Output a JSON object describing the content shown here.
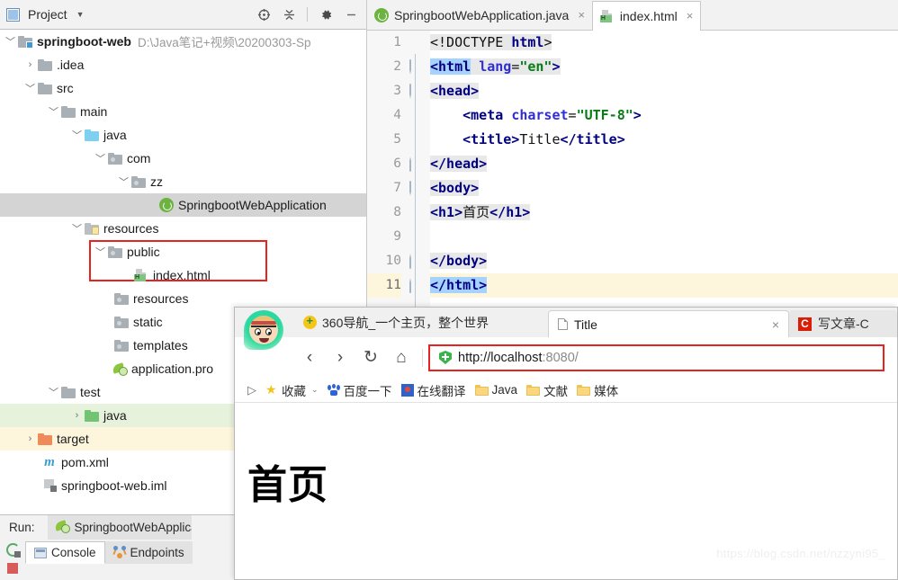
{
  "ide": {
    "project_panel": {
      "title": "Project",
      "toolbar_icons": [
        "locate-icon",
        "collapse-all-icon",
        "settings-gear-icon",
        "minimize-icon"
      ],
      "tree": [
        {
          "label": "springboot-web",
          "path": "D:\\Java笔记+视频\\20200303-Sp",
          "icon": "project-root-folder-icon",
          "arrow": "expanded",
          "indent": 0,
          "bold": true,
          "state": "normal"
        },
        {
          "label": ".idea",
          "path": "",
          "icon": "folder-grey-icon",
          "arrow": "collapsed",
          "indent": 1,
          "bold": false,
          "state": "normal"
        },
        {
          "label": "src",
          "path": "",
          "icon": "folder-grey-icon",
          "arrow": "expanded",
          "indent": 1,
          "bold": false,
          "state": "normal"
        },
        {
          "label": "main",
          "path": "",
          "icon": "folder-grey-icon",
          "arrow": "expanded",
          "indent": 2,
          "bold": false,
          "state": "normal"
        },
        {
          "label": "java",
          "path": "",
          "icon": "folder-blue-source-icon",
          "arrow": "expanded",
          "indent": 3,
          "bold": false,
          "state": "normal"
        },
        {
          "label": "com",
          "path": "",
          "icon": "package-icon",
          "arrow": "expanded",
          "indent": 4,
          "bold": false,
          "state": "normal"
        },
        {
          "label": "zz",
          "path": "",
          "icon": "package-icon",
          "arrow": "expanded",
          "indent": 5,
          "bold": false,
          "state": "normal"
        },
        {
          "label": "SpringbootWebApplication",
          "path": "",
          "icon": "spring-boot-class-icon",
          "arrow": "none",
          "indent": 6,
          "bold": false,
          "state": "selected"
        },
        {
          "label": "resources",
          "path": "",
          "icon": "folder-resources-icon",
          "arrow": "expanded",
          "indent": 3,
          "bold": false,
          "state": "normal"
        },
        {
          "label": "public",
          "path": "",
          "icon": "package-icon",
          "arrow": "expanded",
          "indent": 4,
          "bold": false,
          "state": "normal",
          "highlight": "red-box-top"
        },
        {
          "label": "index.html",
          "path": "",
          "icon": "html-file-icon",
          "arrow": "none",
          "indent": 5,
          "bold": false,
          "state": "normal",
          "highlight": "red-box-bottom"
        },
        {
          "label": "resources",
          "path": "",
          "icon": "package-icon",
          "arrow": "none",
          "indent": 4,
          "bold": false,
          "state": "normal"
        },
        {
          "label": "static",
          "path": "",
          "icon": "package-icon",
          "arrow": "none",
          "indent": 4,
          "bold": false,
          "state": "normal"
        },
        {
          "label": "templates",
          "path": "",
          "icon": "package-icon",
          "arrow": "none",
          "indent": 4,
          "bold": false,
          "state": "normal"
        },
        {
          "label": "application.pro",
          "path": "",
          "icon": "spring-properties-icon",
          "arrow": "none",
          "indent": 4,
          "bold": false,
          "state": "normal"
        },
        {
          "label": "test",
          "path": "",
          "icon": "folder-grey-icon",
          "arrow": "expanded",
          "indent": 2,
          "bold": false,
          "state": "normal"
        },
        {
          "label": "java",
          "path": "",
          "icon": "folder-green-test-icon",
          "arrow": "collapsed",
          "indent": 3,
          "bold": false,
          "state": "green"
        },
        {
          "label": "target",
          "path": "",
          "icon": "folder-orange-icon",
          "arrow": "collapsed",
          "indent": 1,
          "bold": false,
          "state": "yellow"
        },
        {
          "label": "pom.xml",
          "path": "",
          "icon": "maven-m-icon",
          "arrow": "none",
          "indent": 1,
          "bold": false,
          "state": "normal"
        },
        {
          "label": "springboot-web.iml",
          "path": "",
          "icon": "iml-file-icon",
          "arrow": "none",
          "indent": 1,
          "bold": false,
          "state": "normal"
        }
      ]
    },
    "run_panel": {
      "run_label": "Run:",
      "configuration": "SpringbootWebApplica",
      "tabs": [
        {
          "label": "Console",
          "icon": "console-icon",
          "active": true
        },
        {
          "label": "Endpoints",
          "icon": "endpoints-icon",
          "active": false
        }
      ],
      "gutter_icons": [
        "rerun-icon",
        "stop-icon"
      ]
    },
    "editor": {
      "tabs": [
        {
          "label": "SpringbootWebApplication.java",
          "icon": "spring-boot-class-icon",
          "active": false,
          "close": "×"
        },
        {
          "label": "index.html",
          "icon": "html-file-icon",
          "active": true,
          "close": "×"
        }
      ],
      "line_numbers": [
        "1",
        "2",
        "3",
        "4",
        "5",
        "6",
        "7",
        "8",
        "9",
        "10",
        "11"
      ],
      "current_line": 11,
      "code_lines": [
        "<!DOCTYPE html>",
        "<html lang=\"en\">",
        "<head>",
        "    <meta charset=\"UTF-8\">",
        "    <title>Title</title>",
        "</head>",
        "<body>",
        "<h1>首页</h1>",
        "",
        "</body>",
        "</html>"
      ]
    }
  },
  "browser": {
    "avatar": "luffy-avatar-icon",
    "site_title": "360导航_一个主页，整个世界",
    "site_title_icon": "360-badge-icon",
    "tabs": [
      {
        "label": "Title",
        "icon": "page-doc-icon",
        "active": true,
        "close": "×"
      },
      {
        "label": "写文章-C",
        "icon": "csdn-icon",
        "active": false,
        "close": ""
      }
    ],
    "nav": {
      "back": "‹",
      "forward": "›",
      "reload": "↻",
      "home": "⌂"
    },
    "url": {
      "scheme_host": "http://localhost",
      "rest": ":8080/",
      "full": "http://localhost:8080/",
      "security_icon": "green-shield-icon",
      "highlight_color": "#e8231f"
    },
    "bookmarks": [
      {
        "label": "收藏",
        "icon": "star-favorites-icon",
        "caret": "⌄"
      },
      {
        "label": "百度一下",
        "icon": "baidu-icon",
        "caret": ""
      },
      {
        "label": "在线翻译",
        "icon": "translate-icon",
        "caret": ""
      },
      {
        "label": "Java",
        "icon": "bookmark-folder-icon",
        "caret": ""
      },
      {
        "label": "文献",
        "icon": "bookmark-folder-icon",
        "caret": ""
      },
      {
        "label": "媒体",
        "icon": "bookmark-folder-icon",
        "caret": ""
      }
    ],
    "bookmarks_toggle_icon": "show-bookmarks-icon",
    "page": {
      "heading": "首页"
    }
  },
  "watermark": "https://blog.csdn.net/nzzyni95_",
  "colors": {
    "red_highlight": "#e8231f",
    "selection_grey": "#d4d4d4",
    "green_row": "#e7f2dd",
    "yellow_row": "#fdf6dd",
    "tag_blue": "#000080",
    "attr_blue": "#2e2ed4",
    "string_green": "#067d17"
  }
}
